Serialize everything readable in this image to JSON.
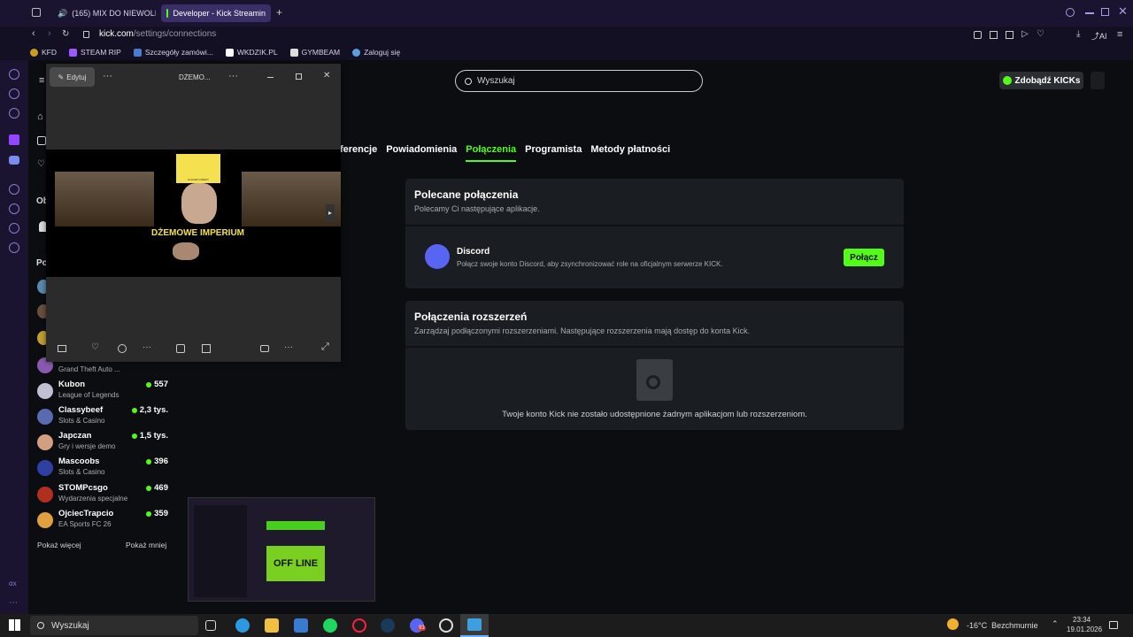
{
  "browser": {
    "tabs": [
      {
        "label": "(165) MIX DO NIEWOLI",
        "favicon_color": "#ff0000"
      },
      {
        "label": "Developer - Kick Streamin",
        "favicon_color": "#53fc18"
      }
    ],
    "url_domain": "kick.com",
    "url_path": "/settings/connections",
    "ai_label": "AI",
    "bookmarks": [
      {
        "label": "KFD",
        "color": "#c8a020"
      },
      {
        "label": "STEAM RIP",
        "color": "#9b59ff"
      },
      {
        "label": "Szczegóły zamówi...",
        "color": "#4a7bd0"
      },
      {
        "label": "WKDZIK.PL",
        "color": "#ffffff"
      },
      {
        "label": "GYMBEAM",
        "color": "#dddddd"
      },
      {
        "label": "Zaloguj się",
        "color": "#5aa0e0"
      }
    ]
  },
  "header": {
    "search_placeholder": "Wyszukaj",
    "kicks_button": "Zdobądź KICKs"
  },
  "settings_tabs": [
    {
      "label": "ferencje",
      "active": false
    },
    {
      "label": "Powiadomienia",
      "active": false
    },
    {
      "label": "Połączenia",
      "active": true
    },
    {
      "label": "Programista",
      "active": false
    },
    {
      "label": "Metody płatności",
      "active": false
    }
  ],
  "recommended": {
    "title": "Polecane połączenia",
    "subtitle": "Polecamy Ci następujące aplikacje.",
    "app_name": "Discord",
    "app_desc": "Połącz swoje konto Discord, aby zsynchronizować role na oficjalnym serwerze KICK.",
    "connect_label": "Połącz"
  },
  "extensions": {
    "title": "Połączenia rozszerzeń",
    "subtitle": "Zarządzaj podłączonymi rozszerzeniami. Następujące rozszerzenia mają dostęp do konta Kick.",
    "empty_text": "Twoje konto Kick nie zostało udostępnione żadnym aplikacjom lub rozszerzeniom."
  },
  "sidebar": {
    "partial_game": "Grand Theft Auto ...",
    "channels": [
      {
        "name": "Kubon",
        "game": "League of Legends",
        "viewers": "557",
        "color": "#c0c0d0"
      },
      {
        "name": "Classybeef",
        "game": "Slots & Casino",
        "viewers": "2,3 tys.",
        "color": "#5a6ab0"
      },
      {
        "name": "Japczan",
        "game": "Gry i wersje demo",
        "viewers": "1,5 tys.",
        "color": "#d0a080"
      },
      {
        "name": "Mascoobs",
        "game": "Slots & Casino",
        "viewers": "396",
        "color": "#3040a0"
      },
      {
        "name": "STOMPcsgo",
        "game": "Wydarzenia specjalne",
        "viewers": "469",
        "color": "#b03020"
      },
      {
        "name": "OjciecTrapcio",
        "game": "EA Sports FC 26",
        "viewers": "359",
        "color": "#e0a040"
      }
    ],
    "show_more": "Pokaż więcej",
    "show_less": "Pokaż mniej",
    "cut_labels": [
      "Ob",
      "Po"
    ]
  },
  "viewer": {
    "edit_label": "Edytuj",
    "title": "DŻEMO...",
    "image_caption": "DŻEMOWE IMPERIUM",
    "crown_text": "GOLDEN DŻEMY"
  },
  "thumbnail": {
    "offline_text": "OFF LINE"
  },
  "taskbar": {
    "search_label": "Wyszukaj",
    "weather": "-16°C  Bezchmurnie",
    "time": "23:34",
    "date": "19.01.2026",
    "badge_count": "93"
  }
}
